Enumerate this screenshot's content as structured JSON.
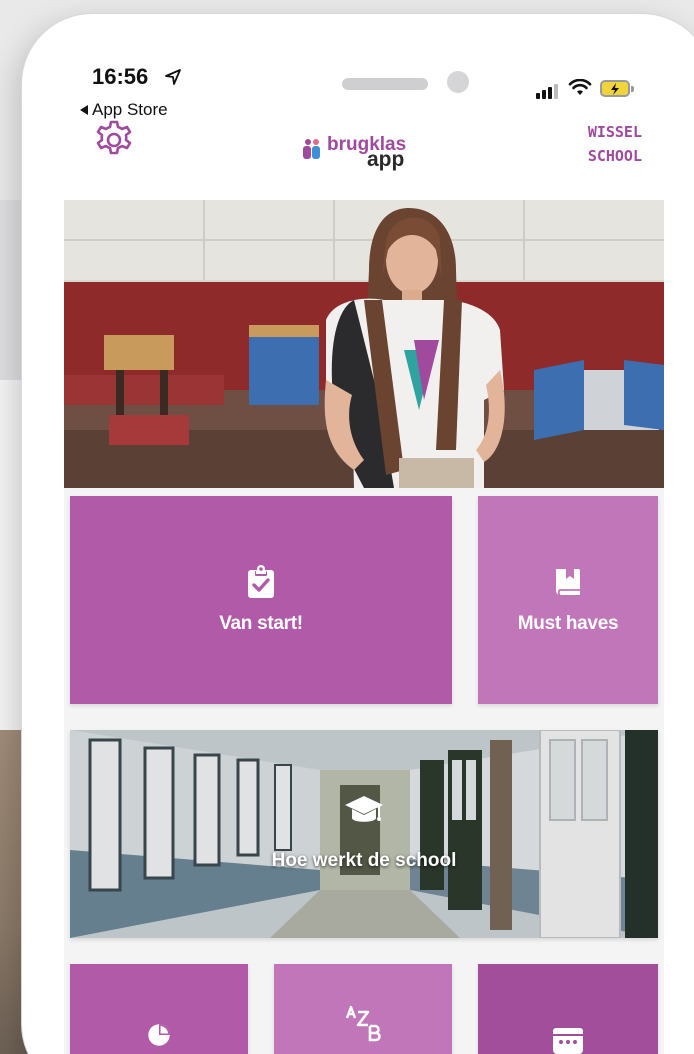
{
  "status_bar": {
    "time": "16:56",
    "back_label": "App Store"
  },
  "header": {
    "logo_brand": "brugklas",
    "logo_sub": "app",
    "switch_school_line1": "WISSEL",
    "switch_school_line2": "SCHOOL"
  },
  "tiles": {
    "van_start": "Van start!",
    "must_haves": "Must haves",
    "hoe_werkt": "Hoe werkt de school"
  },
  "icons": {
    "settings": "gear-icon",
    "van_start": "clipboard-check-icon",
    "must_haves": "book-icon",
    "hoe_werkt": "graduation-cap-icon",
    "bottom_left": "pie-chart-icon",
    "bottom_middle": "a-z-icon",
    "bottom_right": "calendar-icon"
  },
  "colors": {
    "accent": "#a04a9e",
    "tile": "#b15aa8",
    "tile_light": "#c076b9"
  }
}
